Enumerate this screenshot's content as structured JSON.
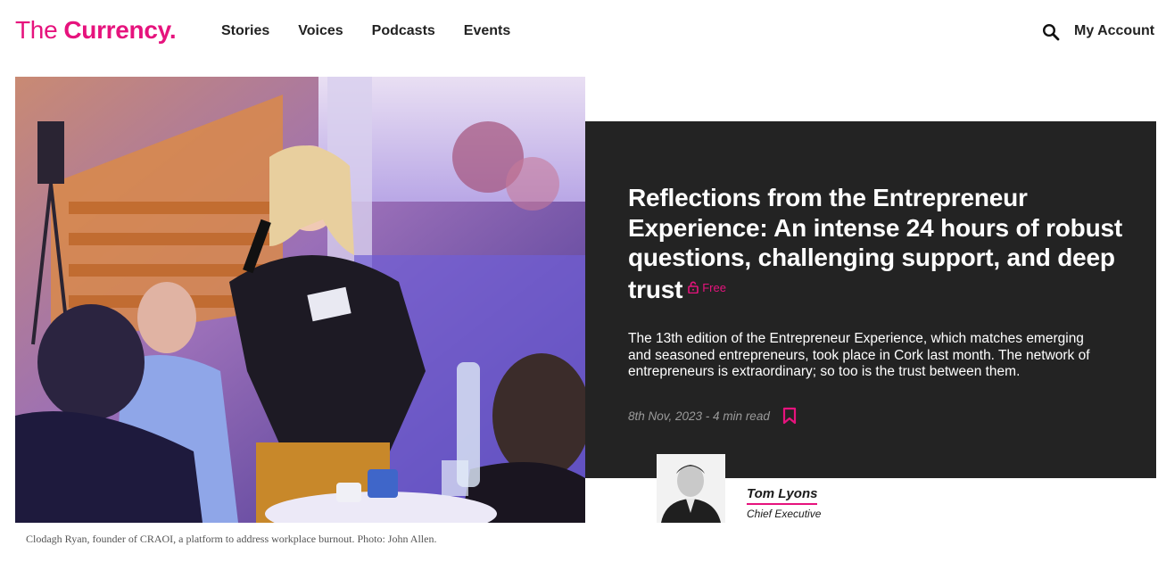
{
  "header": {
    "logo_the": "The",
    "logo_currency": "Currency.",
    "nav": [
      "Stories",
      "Voices",
      "Podcasts",
      "Events"
    ],
    "account_label": "My Account",
    "search_icon": "search-icon"
  },
  "colors": {
    "brand": "#e6137d",
    "panel": "#232323"
  },
  "article": {
    "headline": "Reflections from the Entrepreneur Experience: An intense 24 hours of robust questions, challenging support, and deep trust",
    "access_badge": "Free",
    "access_icon": "unlock-icon",
    "standfirst": "The 13th edition of the Entrepreneur Experience, which matches emerging and seasoned entrepreneurs, took place in Cork last month. The network of entrepreneurs is extraordinary; so too is the trust between them.",
    "meta": "8th Nov, 2023 - 4 min read",
    "bookmark_icon": "bookmark-icon",
    "image_caption": "Clodagh Ryan, founder of CRAOI, a platform to address workplace burnout. Photo: John Allen."
  },
  "author": {
    "name": "Tom Lyons",
    "role": "Chief Executive"
  }
}
